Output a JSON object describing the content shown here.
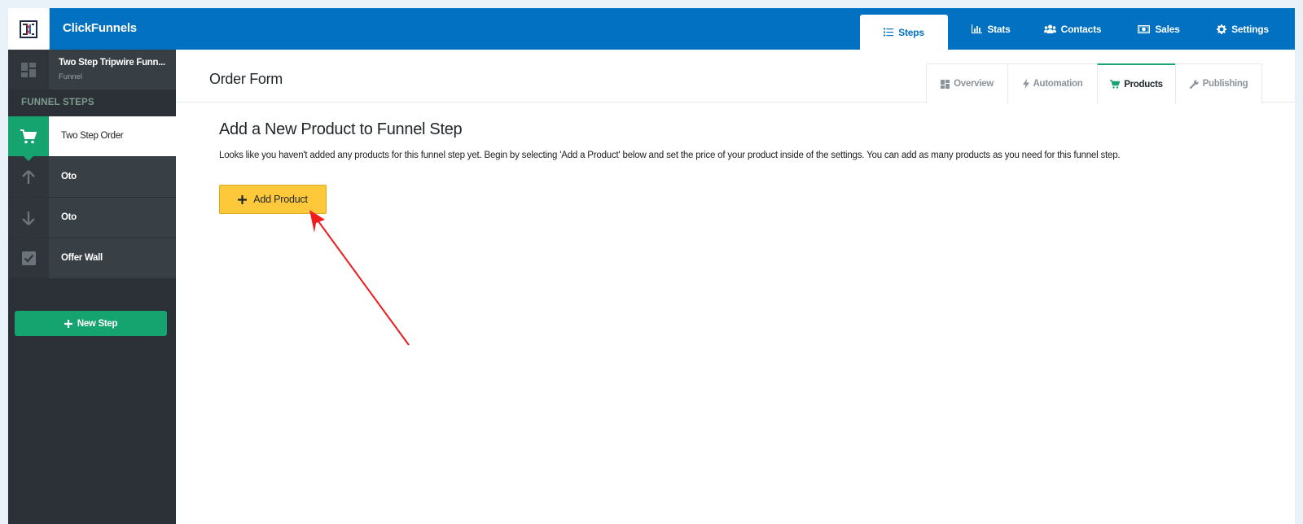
{
  "header": {
    "brand": "ClickFunnels",
    "nav": [
      {
        "label": "Steps",
        "icon": "list-icon",
        "active": true
      },
      {
        "label": "Stats",
        "icon": "bar-chart-icon"
      },
      {
        "label": "Contacts",
        "icon": "users-icon"
      },
      {
        "label": "Sales",
        "icon": "money-icon"
      },
      {
        "label": "Settings",
        "icon": "gear-icon"
      }
    ]
  },
  "sidebar": {
    "funnel_name": "Two Step Tripwire Funn...",
    "funnel_type": "Funnel",
    "section_title": "FUNNEL STEPS",
    "steps": [
      {
        "label": "Two Step Order",
        "icon": "cart-icon",
        "active": true
      },
      {
        "label": "Oto",
        "icon": "arrow-up-icon"
      },
      {
        "label": "Oto",
        "icon": "arrow-down-icon"
      },
      {
        "label": "Offer Wall",
        "icon": "checkbox-icon"
      }
    ],
    "new_step_label": "New Step"
  },
  "main": {
    "page_title": "Order Form",
    "tabs": [
      {
        "label": "Overview",
        "icon": "grid-icon"
      },
      {
        "label": "Automation",
        "icon": "bolt-icon"
      },
      {
        "label": "Products",
        "icon": "cart-icon",
        "active": true
      },
      {
        "label": "Publishing",
        "icon": "wrench-icon"
      }
    ],
    "content_title": "Add a New Product to Funnel Step",
    "content_desc": "Looks like you haven't added any products for this funnel step yet. Begin by selecting 'Add a Product' below and set the price of your product inside of the settings. You can add as many products as you need for this funnel step.",
    "add_product_label": "Add Product"
  },
  "colors": {
    "brand_blue": "#0271c1",
    "accent_green": "#15a46f",
    "sidebar_dark": "#2b3136",
    "button_yellow": "#fdc93b",
    "annotation_red": "#ee1c1c"
  }
}
